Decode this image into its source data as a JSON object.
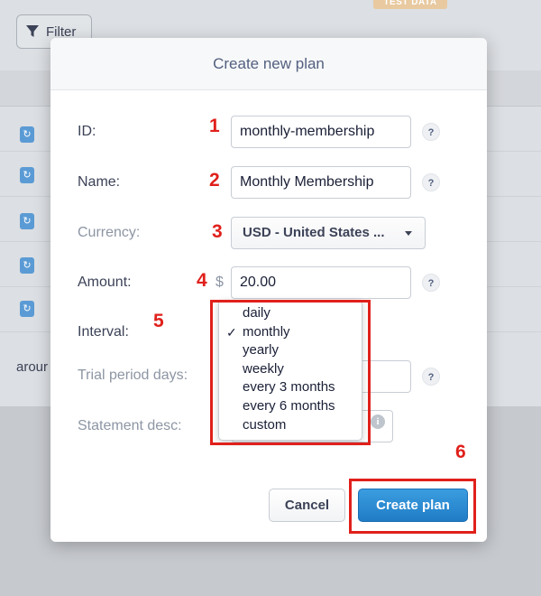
{
  "background": {
    "filter_label": "Filter",
    "test_data_badge": "TEST DATA",
    "partial_text": "arour"
  },
  "modal": {
    "title": "Create new plan",
    "fields": {
      "id": {
        "label": "ID:",
        "value": "monthly-membership"
      },
      "name": {
        "label": "Name:",
        "value": "Monthly Membership"
      },
      "currency": {
        "label": "Currency:",
        "value": "USD - United States ..."
      },
      "amount": {
        "label": "Amount:",
        "currency_symbol": "$",
        "value": "20.00"
      },
      "interval": {
        "label": "Interval:",
        "selected": "monthly"
      },
      "trial": {
        "label": "Trial period days:"
      },
      "statement": {
        "label": "Statement desc:"
      }
    },
    "help_icon_text": "?",
    "info_icon_text": "i",
    "interval_options": [
      "daily",
      "monthly",
      "yearly",
      "weekly",
      "every 3 months",
      "every 6 months",
      "custom"
    ],
    "check_mark": "✓",
    "buttons": {
      "cancel": "Cancel",
      "create": "Create plan"
    }
  },
  "annotations": [
    "1",
    "2",
    "3",
    "4",
    "5",
    "6"
  ],
  "colors": {
    "annotation_red": "#e0201b",
    "primary_button": "#1f7cc5",
    "badge_orange": "#e8c9a0"
  }
}
